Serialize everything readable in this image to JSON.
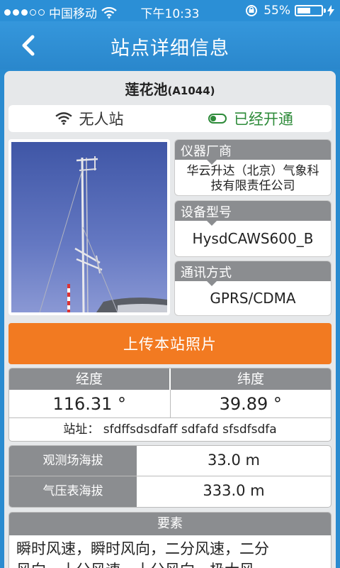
{
  "status_bar": {
    "carrier": "中国移动",
    "time": "下午10:33",
    "battery": "55%",
    "battery_level": 0.55
  },
  "nav": {
    "title": "站点详细信息",
    "back_icon": "chevron-left-icon"
  },
  "station": {
    "name": "莲花池",
    "code": "(A1044)",
    "type_label": "无人站",
    "status_label": "已经开通"
  },
  "device": {
    "manufacturer_label": "仪器厂商",
    "manufacturer_line1": "华云升达（北京）气象科",
    "manufacturer_line2": "技有限责任公司",
    "model_label": "设备型号",
    "model_value": "HysdCAWS600_B",
    "comm_label": "通讯方式",
    "comm_value": "GPRS/CDMA"
  },
  "upload_button": "上传本站照片",
  "coordinates": {
    "lon_label": "经度",
    "lat_label": "纬度",
    "lon_value": "116.31 °",
    "lat_value": "39.89 °",
    "address": "站址： sfdffsdsdfaff sdfafd sfsdfsdfa"
  },
  "altitude": {
    "field_label": "观测场海拔",
    "field_value": "33.0 m",
    "baro_label": "气压表海拔",
    "baro_value": "333.0 m"
  },
  "elements": {
    "label": "要素",
    "line1": "瞬时风速，瞬时风向，二分风速，二分",
    "line2": "风向，十分风速，十分风向，极大风"
  },
  "colors": {
    "primary": "#2a8bd0",
    "accent": "#f27a21",
    "status_on": "#2e8b3a",
    "header_gray": "#8b8d90"
  }
}
